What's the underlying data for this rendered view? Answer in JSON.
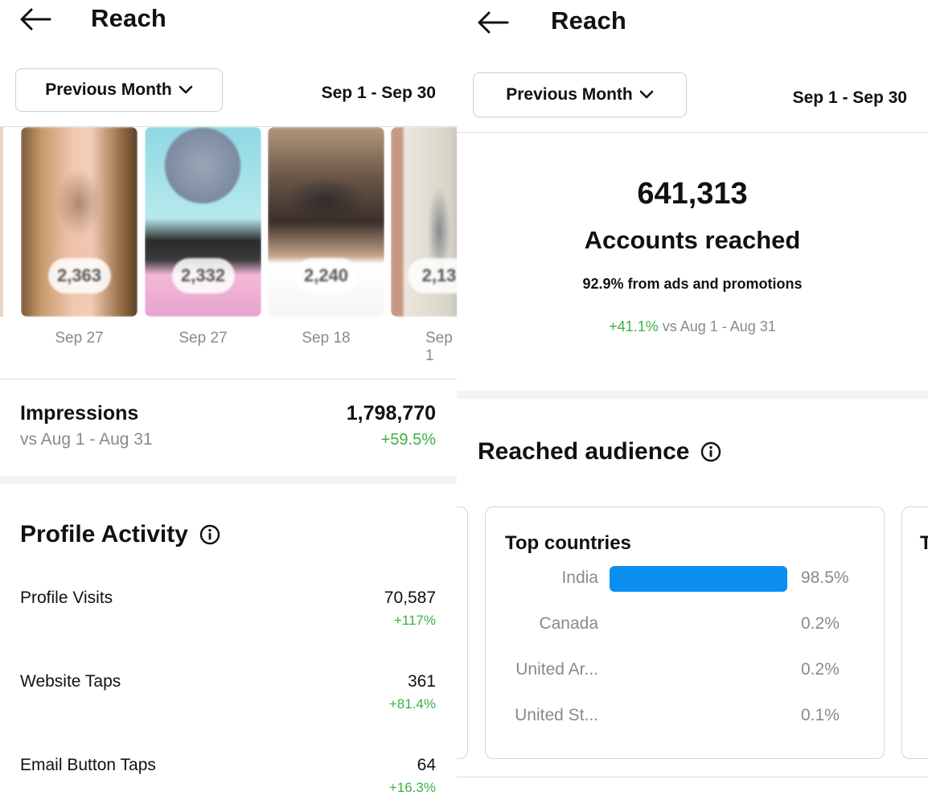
{
  "left": {
    "title": "Reach",
    "period_button": "Previous Month",
    "date_range": "Sep 1 - Sep 30",
    "posts": [
      {
        "count": "2,363",
        "date": "Sep 27"
      },
      {
        "count": "2,332",
        "date": "Sep 27"
      },
      {
        "count": "2,240",
        "date": "Sep 18"
      },
      {
        "count": "2,13",
        "date": "Sep 1"
      }
    ],
    "impressions": {
      "label": "Impressions",
      "compare": "vs Aug 1 - Aug 31",
      "value": "1,798,770",
      "change": "+59.5%"
    },
    "profile_activity": {
      "title": "Profile Activity",
      "items": [
        {
          "label": "Profile Visits",
          "value": "70,587",
          "change": "+117%"
        },
        {
          "label": "Website Taps",
          "value": "361",
          "change": "+81.4%"
        },
        {
          "label": "Email Button Taps",
          "value": "64",
          "change": "+16.3%"
        }
      ]
    }
  },
  "right": {
    "title": "Reach",
    "period_button": "Previous Month",
    "date_range": "Sep 1 - Sep 30",
    "accounts_reached": {
      "value": "641,313",
      "label": "Accounts reached",
      "ads_note": "92.9% from ads and promotions",
      "change": "+41.1%",
      "compare": "vs Aug 1 - Aug 31"
    },
    "reached_audience": {
      "title": "Reached audience",
      "top_countries": {
        "title": "Top countries",
        "rows": [
          {
            "name": "India",
            "pct": "98.5%",
            "fraction": 0.985
          },
          {
            "name": "Canada",
            "pct": "0.2%",
            "fraction": 0.002
          },
          {
            "name": "United Ar...",
            "pct": "0.2%",
            "fraction": 0.002
          },
          {
            "name": "United St...",
            "pct": "0.1%",
            "fraction": 0.001
          }
        ]
      },
      "next_card_initial": "T"
    }
  },
  "colors": {
    "positive": "#3cb043",
    "bar": "#0a8ff0",
    "muted": "#8a8a8a"
  },
  "icons": [
    "back-arrow-icon",
    "chevron-down-icon",
    "info-icon"
  ]
}
